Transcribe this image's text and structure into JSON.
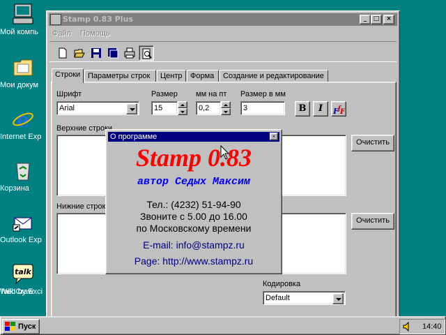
{
  "desktop": {
    "icons": [
      {
        "name": "my-computer-icon",
        "label": "Мой компь"
      },
      {
        "name": "my-documents-icon",
        "label": "Мои докум"
      },
      {
        "name": "internet-explorer-icon",
        "label": "Internet Exp"
      },
      {
        "name": "recycle-bin-icon",
        "label": "Корзина"
      },
      {
        "name": "outlook-express-icon",
        "label": "Outlook Exp"
      },
      {
        "name": "talk-icon",
        "label": "Talk! by Exci",
        "label2": "WebCraw"
      }
    ]
  },
  "window": {
    "title": "Stamp 0.83 Plus",
    "menu": [
      "Файл",
      "Помощь"
    ],
    "toolbar_icons": [
      "new-file-icon",
      "open-folder-icon",
      "save-icon",
      "save-as-icon",
      "print-icon",
      "print-preview-icon"
    ],
    "tabs": [
      {
        "label": "Строки",
        "active": true
      },
      {
        "label": "Параметры строк",
        "active": false
      },
      {
        "label": "Центр",
        "active": false
      },
      {
        "label": "Форма",
        "active": false
      },
      {
        "label": "Создание и редактирование",
        "active": false
      }
    ],
    "font": {
      "label": "Шрифт",
      "value": "Arial"
    },
    "size": {
      "label": "Размер",
      "value": "15"
    },
    "mm_per_pt": {
      "label": "мм на пт",
      "value": "0,2"
    },
    "size_mm": {
      "label": "Размер в мм",
      "value": "3"
    },
    "format_buttons": {
      "bold": "B",
      "italic": "I",
      "font": "F"
    },
    "upper_lines": {
      "label": "Верхние строки"
    },
    "lower_lines": {
      "label": "Нижние строки"
    },
    "clear_label": "Очистить",
    "encoding": {
      "label": "Кодировка",
      "value": "Default"
    }
  },
  "about": {
    "title": "О программе",
    "app_name": "Stamp 0.83",
    "author": "автор Седых Максим",
    "phone": "Тел.: (4232) 51-94-90",
    "hours": "Звоните с 5.00 до 16.00",
    "timezone": "по Московскому времени",
    "email": "E-mail: info@stampz.ru",
    "page": "Page: http://www.stampz.ru"
  },
  "taskbar": {
    "start_label": "Пуск",
    "clock": "14:40"
  },
  "colors": {
    "desktop": "#008080",
    "face": "#c0c0c0",
    "title_active": "#000080",
    "stamp_red": "#ff0000",
    "author_blue": "#0000ff"
  }
}
